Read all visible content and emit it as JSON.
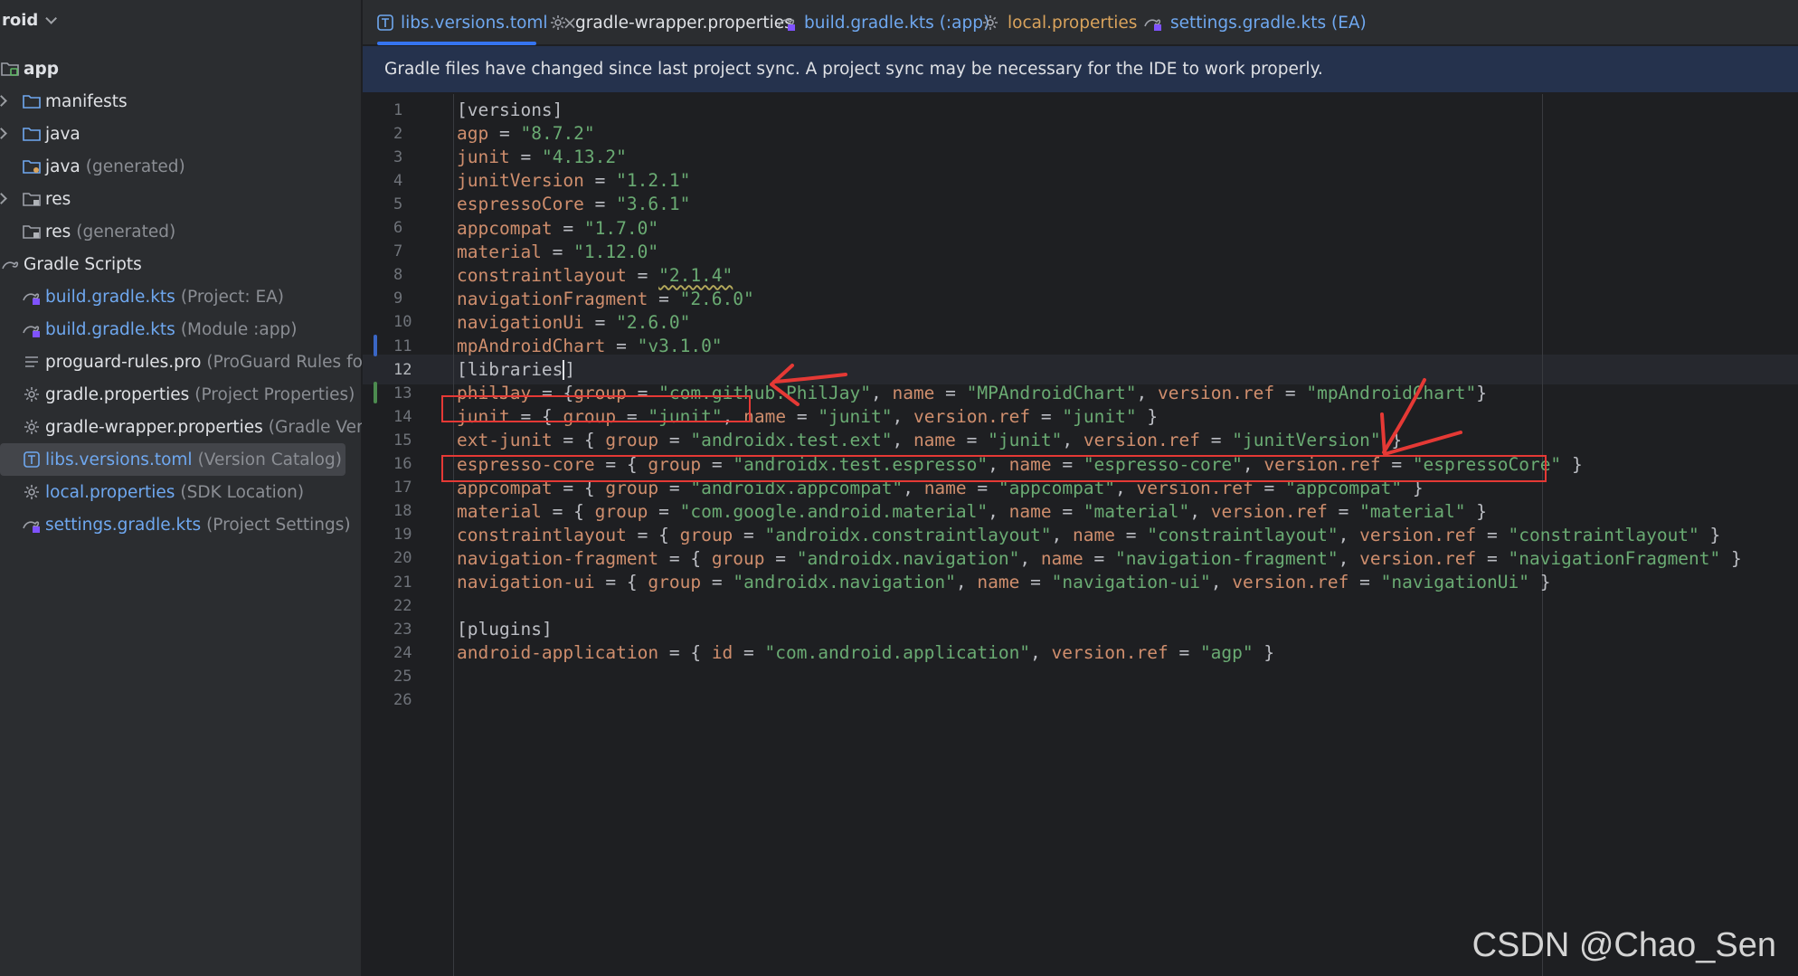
{
  "sidebar": {
    "header": "roid",
    "items": [
      {
        "name": "app",
        "hint": "",
        "icon": "module-icon"
      },
      {
        "name": "manifests",
        "hint": "",
        "icon": "folder-icon"
      },
      {
        "name": "java",
        "hint": "",
        "icon": "folder-icon"
      },
      {
        "name": "java",
        "hint": "(generated)",
        "icon": "folder-gen-icon"
      },
      {
        "name": "res",
        "hint": "",
        "icon": "res-folder-icon"
      },
      {
        "name": "res",
        "hint": "(generated)",
        "icon": "res-folder-icon"
      },
      {
        "name": "Gradle Scripts",
        "hint": "",
        "icon": "gradle-icon"
      },
      {
        "name": "build.gradle.kts",
        "hint": "(Project: EA)",
        "icon": "gradle-kts-icon"
      },
      {
        "name": "build.gradle.kts",
        "hint": "(Module :app)",
        "icon": "gradle-kts-icon"
      },
      {
        "name": "proguard-rules.pro",
        "hint": "(ProGuard Rules for '",
        "icon": "text-file-icon"
      },
      {
        "name": "gradle.properties",
        "hint": "(Project Properties)",
        "icon": "settings-file-icon"
      },
      {
        "name": "gradle-wrapper.properties",
        "hint": "(Gradle Versio",
        "icon": "settings-file-icon"
      },
      {
        "name": "libs.versions.toml",
        "hint": "(Version Catalog)",
        "icon": "toml-icon"
      },
      {
        "name": "local.properties",
        "hint": "(SDK Location)",
        "icon": "settings-file-icon"
      },
      {
        "name": "settings.gradle.kts",
        "hint": "(Project Settings)",
        "icon": "gradle-kts-icon"
      }
    ]
  },
  "tabs": [
    {
      "label": "libs.versions.toml",
      "icon": "toml-icon",
      "color": "#6fa8f0"
    },
    {
      "label": "gradle-wrapper.properties",
      "icon": "settings-file-icon",
      "color": "#dfe1e5"
    },
    {
      "label": "build.gradle.kts (:app)",
      "icon": "gradle-kts-icon",
      "color": "#6fa8f0"
    },
    {
      "label": "local.properties",
      "icon": "settings-file-icon",
      "color": "#d9a35c"
    },
    {
      "label": "settings.gradle.kts (EA)",
      "icon": "gradle-kts-icon",
      "color": "#6fa8f0"
    }
  ],
  "tab_close_glyph": "×",
  "banner": "Gradle files have changed since last project sync. A project sync may be necessary for the IDE to work properly.",
  "editor": {
    "current_line": 12,
    "line_numbers": [
      "1",
      "2",
      "3",
      "4",
      "5",
      "6",
      "7",
      "8",
      "9",
      "10",
      "11",
      "12",
      "13",
      "14",
      "15",
      "16",
      "17",
      "18",
      "19",
      "20",
      "21",
      "22",
      "23",
      "24",
      "25",
      "26"
    ],
    "lines": [
      "[versions]",
      "agp = \"8.7.2\"",
      "junit = \"4.13.2\"",
      "junitVersion = \"1.2.1\"",
      "espressoCore = \"3.6.1\"",
      "appcompat = \"1.7.0\"",
      "material = \"1.12.0\"",
      "constraintlayout = \"2.1.4\"",
      "navigationFragment = \"2.6.0\"",
      "navigationUi = \"2.6.0\"",
      "mpAndroidChart = \"v3.1.0\"",
      "[libraries]",
      "philJay = {group = \"com.github.PhilJay\", name = \"MPAndroidChart\", version.ref = \"mpAndroidChart\"}",
      "junit = { group = \"junit\", name = \"junit\", version.ref = \"junit\" }",
      "ext-junit = { group = \"androidx.test.ext\", name = \"junit\", version.ref = \"junitVersion\" }",
      "espresso-core = { group = \"androidx.test.espresso\", name = \"espresso-core\", version.ref = \"espressoCore\" }",
      "appcompat = { group = \"androidx.appcompat\", name = \"appcompat\", version.ref = \"appcompat\" }",
      "material = { group = \"com.google.android.material\", name = \"material\", version.ref = \"material\" }",
      "constraintlayout = { group = \"androidx.constraintlayout\", name = \"constraintlayout\", version.ref = \"constraintlayout\" }",
      "navigation-fragment = { group = \"androidx.navigation\", name = \"navigation-fragment\", version.ref = \"navigationFragment\" }",
      "navigation-ui = { group = \"androidx.navigation\", name = \"navigation-ui\", version.ref = \"navigationUi\" }",
      "",
      "[plugins]",
      "android-application = { id = \"com.android.application\", version.ref = \"agp\" }",
      "",
      ""
    ]
  },
  "colors": {
    "keyword": "#cf8e6d",
    "string": "#6aab73",
    "punct": "#bcbec4",
    "annotation": "#e53935",
    "tab_active_underline": "#3574f0"
  },
  "watermark": "CSDN @Chao_Sen"
}
